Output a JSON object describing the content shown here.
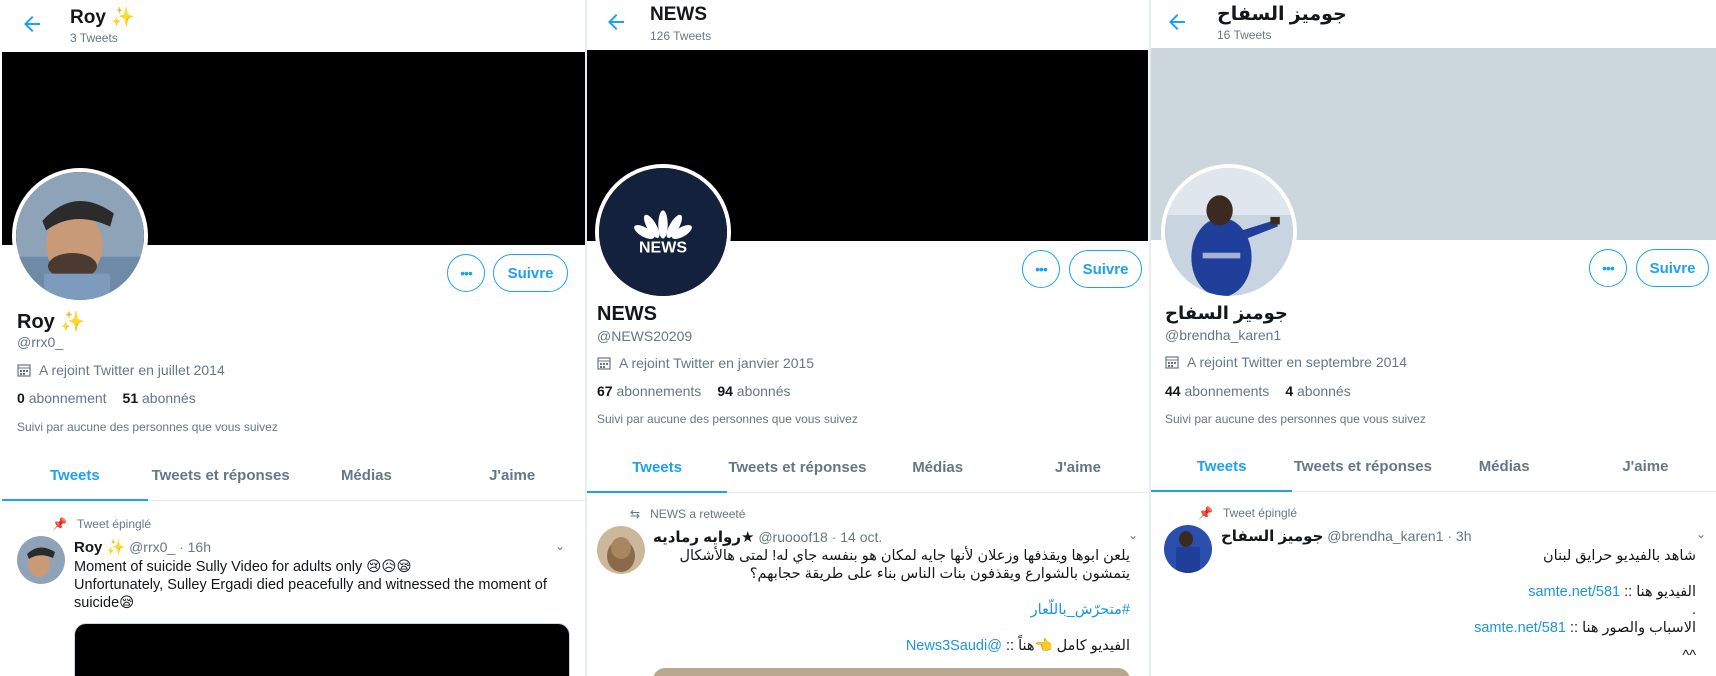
{
  "panels": [
    {
      "topbar": {
        "name": "Roy ✨",
        "count": "3 Tweets"
      },
      "banner_color": "#000000",
      "profile": {
        "name": "Roy ✨",
        "handle": "@rrx0_",
        "joined": "A rejoint Twitter en juillet 2014",
        "following_count": "0",
        "following_label": "abonnement",
        "followers_count": "51",
        "followers_label": "abonnés",
        "followed_by": "Suivi par aucune des personnes que vous suivez"
      },
      "buttons": {
        "more": "•••",
        "follow": "Suivre"
      },
      "tabs": [
        "Tweets",
        "Tweets et réponses",
        "Médias",
        "J'aime"
      ],
      "tweet": {
        "context": "Tweet épinglé",
        "name": "Roy ✨",
        "meta": "@rrx0_ · 16h",
        "line1": "Moment of suicide Sully Video for adults only 😢😥😪",
        "line2": "Unfortunately, Sulley Ergadi died peacefully and witnessed the moment of",
        "line3": "suicide😪"
      }
    },
    {
      "topbar": {
        "name": "NEWS",
        "count": "126 Tweets"
      },
      "banner_color": "#000000",
      "avatar_text": "NEWS",
      "profile": {
        "name": "NEWS",
        "handle": "@NEWS20209",
        "joined": "A rejoint Twitter en janvier 2015",
        "following_count": "67",
        "following_label": "abonnements",
        "followers_count": "94",
        "followers_label": "abonnés",
        "followed_by": "Suivi par aucune des personnes que vous suivez"
      },
      "buttons": {
        "more": "•••",
        "follow": "Suivre"
      },
      "tabs": [
        "Tweets",
        "Tweets et réponses",
        "Médias",
        "J'aime"
      ],
      "tweet": {
        "context": "NEWS a retweeté",
        "name": "روايه رماديه★",
        "meta": "@ruooof18 · 14 oct.",
        "line1": "يلعن ابوها ويقذفها وزعلان لأنها جايه لمكان هو بنفسه جاي له! لمتى هالأشكال",
        "line2": "يتمشون بالشوارع ويقذفون بنات الناس بناء على طريقة حجابهم؟",
        "hashtag": "#متحرّش_باللّعار",
        "line3": "الفيديو كامل 👈هناً :: ",
        "mention": "@News3Saudi"
      }
    },
    {
      "topbar": {
        "name": "جوميز السفاح",
        "count": "16 Tweets"
      },
      "banner_color": "#ccd6dd",
      "profile": {
        "name": "جوميز السفاح",
        "handle": "@brendha_karen1",
        "joined": "A rejoint Twitter en septembre 2014",
        "following_count": "44",
        "following_label": "abonnements",
        "followers_count": "4",
        "followers_label": "abonnés",
        "followed_by": "Suivi par aucune des personnes que vous suivez"
      },
      "buttons": {
        "more": "•••",
        "follow": "Suivre"
      },
      "tabs": [
        "Tweets",
        "Tweets et réponses",
        "Médias",
        "J'aime"
      ],
      "tweet": {
        "context": "Tweet épinglé",
        "name": "جوميز السفاح",
        "meta": "@brendha_karen1 · 3h",
        "line1": "شاهد بالفيديو حرايق لبنان",
        "line2_label": "الفيديو هنا :: ",
        "line2_link": "samte.net/581",
        "dot": ".",
        "line3_label": "الاسباب والصور هنا :: ",
        "line3_link": "samte.net/581",
        "tail": "^^"
      }
    }
  ],
  "colors": {
    "accent": "#1da1f2",
    "muted": "#657786",
    "text": "#14171a",
    "border": "#e6ecf0"
  },
  "icons": [
    "back-arrow-icon",
    "calendar-icon",
    "pin-icon",
    "retweet-icon",
    "chevron-down-icon",
    "more-icon"
  ]
}
